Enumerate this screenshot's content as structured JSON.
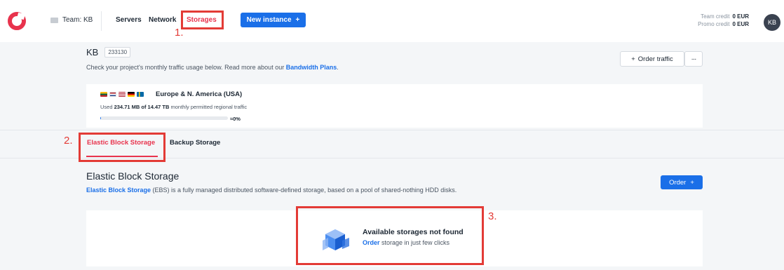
{
  "brand": {
    "logo": "logo-icon"
  },
  "header": {
    "team_label": "Team: KB",
    "nav": {
      "servers": "Servers",
      "network": "Network",
      "storages": "Storages"
    },
    "new_instance": "New instance",
    "team_credit_label": "Team credit",
    "team_credit_value": "0 EUR",
    "promo_credit_label": "Promo credit",
    "promo_credit_value": "0 EUR",
    "avatar": "KB"
  },
  "project": {
    "name": "KB",
    "id": "233130",
    "desc_text": "Check your project's monthly traffic usage below. Read more about our ",
    "desc_link": "Bandwidth Plans",
    "desc_end": ".",
    "order_traffic": "Order traffic",
    "more": "···"
  },
  "traffic": {
    "region": "Europe & N. America (USA)",
    "used_prefix": "Used ",
    "used_amount": "234.71 MB of 14.47 TB",
    "used_suffix": " monthly permitted regional traffic",
    "percent": "≈0%",
    "progress_fraction": 0.002
  },
  "tabs": {
    "elastic": "Elastic Block Storage",
    "backup": "Backup Storage"
  },
  "ebs": {
    "title": "Elastic Block Storage",
    "desc_link": "Elastic Block Storage",
    "desc_text": " (EBS) is a fully managed distributed software-defined storage, based on a pool of shared-nothing HDD disks.",
    "order": "Order",
    "empty_title": "Available storages not found",
    "empty_link": "Order",
    "empty_text": " storage in just few clicks"
  },
  "annotations": {
    "one": "1.",
    "two": "2.",
    "three": "3."
  },
  "colors": {
    "accent": "#1a6fe8",
    "active": "#e8334d",
    "annotation": "#e33b36"
  }
}
